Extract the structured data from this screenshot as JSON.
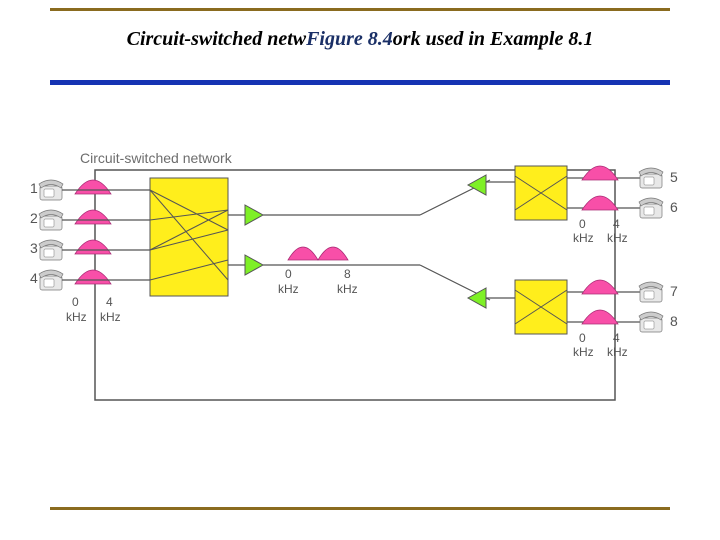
{
  "title": {
    "prefix": "Circuit-switched netw",
    "figure": "Figure 8.4",
    "middle": "ork used i",
    "suffix": "n Example 8.1"
  },
  "caption": "Circuit-switched network",
  "phones": {
    "left": [
      "1",
      "2",
      "3",
      "4"
    ],
    "right_top": [
      "5",
      "6"
    ],
    "right_bottom": [
      "7",
      "8"
    ]
  },
  "axis": {
    "zero": "0",
    "four": "4",
    "eight": "8",
    "khz": "kHz"
  }
}
